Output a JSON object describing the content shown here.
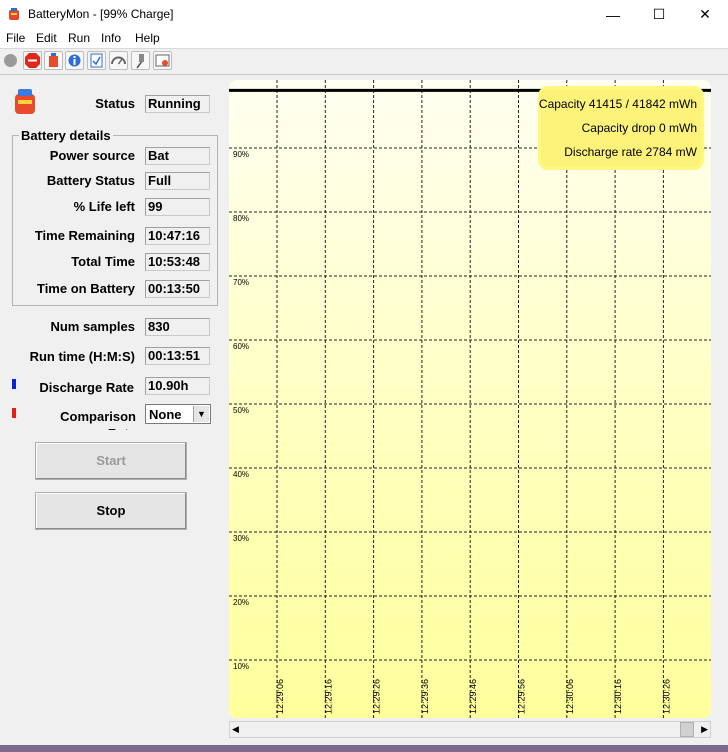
{
  "window": {
    "title": "BatteryMon - [99% Charge]",
    "minimize": "—",
    "maximize": "☐",
    "close": "✕"
  },
  "menu": {
    "items": [
      "File",
      "Edit",
      "Run",
      "Info",
      "Help"
    ]
  },
  "toolbar": {
    "icons": [
      "record-icon",
      "stop-icon",
      "battery-icon",
      "info-icon",
      "checklist-icon",
      "gauge-icon",
      "pin-icon",
      "settings-icon"
    ]
  },
  "status": {
    "label": "Status",
    "value": "Running"
  },
  "details": {
    "title": "Battery details",
    "power_source": {
      "label": "Power source",
      "value": "Bat"
    },
    "battery_status": {
      "label": "Battery Status",
      "value": "Full"
    },
    "life_left": {
      "label": "% Life left",
      "value": "99"
    },
    "time_remaining": {
      "label": "Time Remaining",
      "value": "10:47:16"
    },
    "total_time": {
      "label": "Total Time",
      "value": "10:53:48"
    },
    "time_on_battery": {
      "label": "Time on Battery",
      "value": "00:13:50"
    }
  },
  "num_samples": {
    "label": "Num samples",
    "value": "830"
  },
  "run_time": {
    "label": "Run time (H:M:S)",
    "value": "00:13:51"
  },
  "discharge_rate": {
    "label": "Discharge Rate",
    "value": "10.90h",
    "color": "#0a1fd6"
  },
  "comparison": {
    "label": "Comparison Rate",
    "value": "None",
    "color": "#e0201a"
  },
  "buttons": {
    "start": "Start",
    "stop": "Stop"
  },
  "info_box": {
    "capacity": "Capacity 41415 / 41842 mWh",
    "capacity_drop": "Capacity drop 0 mWh",
    "discharge_rate": "Discharge rate 2784 mW"
  },
  "chart_data": {
    "type": "line",
    "xlabel": "",
    "ylabel": "",
    "yticks": [
      "90%",
      "80%",
      "70%",
      "60%",
      "50%",
      "40%",
      "30%",
      "20%",
      "10%"
    ],
    "xticks": [
      "12:29:06",
      "12:29:16",
      "12:29:26",
      "12:29:36",
      "12:29:46",
      "12:29:56",
      "12:30:06",
      "12:30:16",
      "12:30:26"
    ],
    "ylim": [
      0,
      100
    ],
    "grid": true,
    "series": [
      {
        "values": [
          99,
          99,
          99,
          99,
          99,
          99,
          99,
          99,
          99
        ]
      }
    ]
  }
}
